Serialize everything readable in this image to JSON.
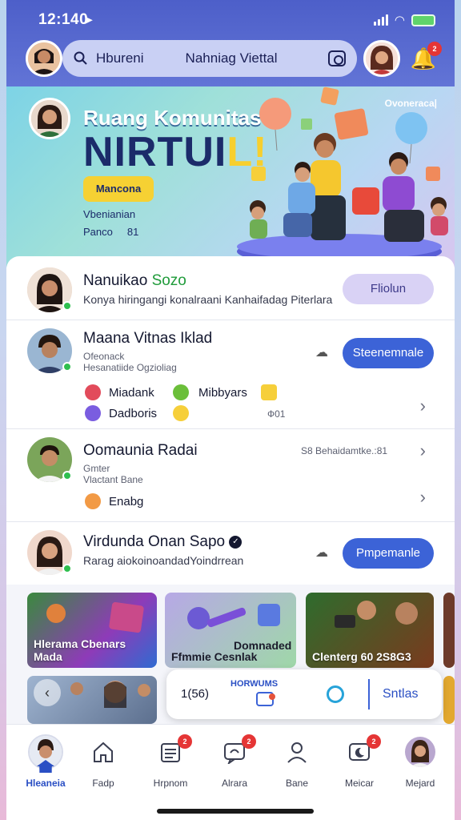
{
  "status_bar": {
    "time": "12:140"
  },
  "header": {
    "search_text": "Hbureni",
    "search_title": "Nahniag Viettal",
    "notification_badge": "2"
  },
  "hero": {
    "title": "Ruang Komunitas",
    "big_title_main": "NIRTUI",
    "big_title_accent": "L!",
    "corner_label": "Ovoneraca|",
    "cta_label": "Mancona",
    "subtitle": "Vbenianian",
    "meta_1": "Panco",
    "meta_2": "81"
  },
  "chats": [
    {
      "name": "Nanuikao",
      "name_highlight": "Sozo",
      "message": "Konya hiringangi konalraani Kanhaifadag Piterlara",
      "action": "Fliolun"
    },
    {
      "name": "Maana Vitnas Iklad",
      "line1": "Ofeonack",
      "line2": "Hesanatiide Ogzioliag",
      "action": "Steenemnale",
      "reactions": [
        {
          "label": "Miadank",
          "color": "#e24b5b"
        },
        {
          "label": "Mibbyars",
          "color": "#6bbf3a"
        },
        {
          "label": "Dadboris",
          "color": "#7a5de0"
        }
      ],
      "count": "Ф01"
    },
    {
      "name": "Oomaunia Radai",
      "line1": "Gmter",
      "line2": "Vlactant Bane",
      "timestamp": "S8 Behaidamtke.:81",
      "reaction_label": "Enabg"
    },
    {
      "name": "Virdunda Onan Sapo",
      "message": "Rarag aiokoinoandadYoindrrean",
      "action": "Pmpemanle"
    }
  ],
  "cards": [
    {
      "label": "Hlerama Cbenars Mada",
      "bg": "#3a8a3d"
    },
    {
      "label": "Ffmmie Cesnlak",
      "label2": "Domnaded",
      "bg": "#b7a8e6"
    },
    {
      "label": "Clenterg 60  2S8G3",
      "bg": "#2e6c2d"
    }
  ],
  "player": {
    "time": "1(56)",
    "title": "HORWUMS",
    "action": "Sntlas"
  },
  "tabs": [
    {
      "label": "Hleaneia",
      "badge": ""
    },
    {
      "label": "Fadp",
      "badge": ""
    },
    {
      "label": "Hrpnom",
      "badge": "2"
    },
    {
      "label": "Alrara",
      "badge": "2"
    },
    {
      "label": "Bane",
      "badge": ""
    },
    {
      "label": "Meicar",
      "badge": "2"
    },
    {
      "label": "Mejard",
      "badge": ""
    }
  ],
  "colors": {
    "header": "#4d5fc9",
    "accent": "#3c63d7",
    "cta": "#f6d133",
    "online": "#2fbf4f",
    "badge": "#e53535"
  }
}
